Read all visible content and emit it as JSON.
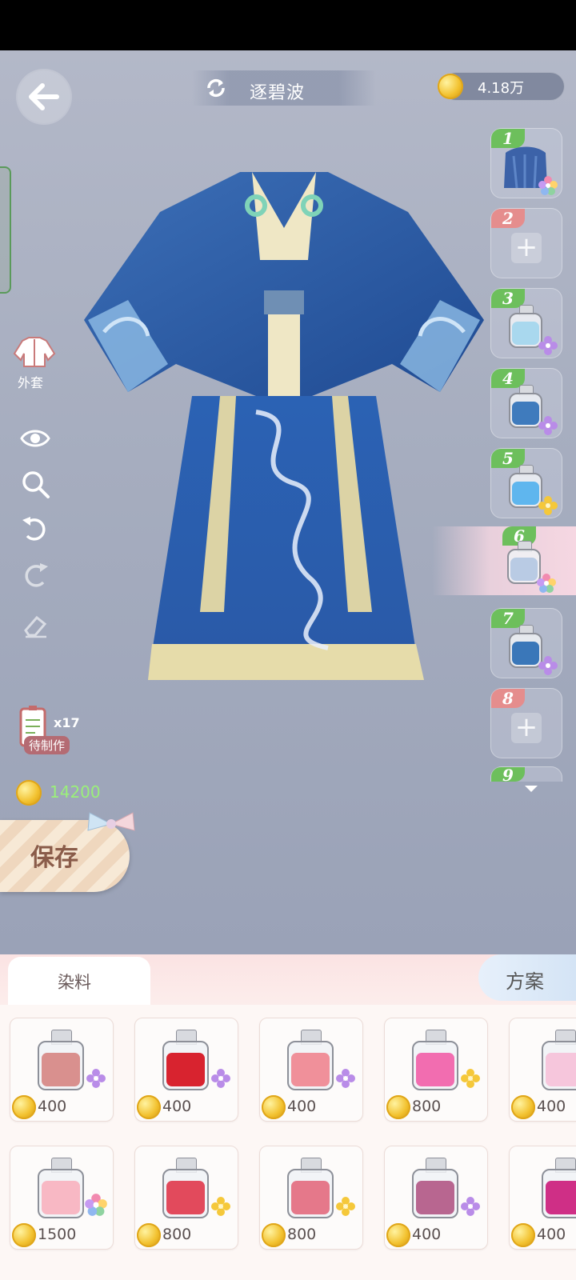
{
  "header": {
    "outfit_name": "逐碧波",
    "currency": "4.18万"
  },
  "toolbar": {
    "coat_label": "外套"
  },
  "craft": {
    "count": "x17",
    "label": "待制作",
    "cost": "14200"
  },
  "save_label": "保存",
  "slots": [
    {
      "num": "1",
      "state": "filled-fabric"
    },
    {
      "num": "2",
      "state": "empty"
    },
    {
      "num": "3",
      "state": "filled",
      "color": "#a9d8ee",
      "flower": "purple"
    },
    {
      "num": "4",
      "state": "filled",
      "color": "#3f7bbd",
      "flower": "purple"
    },
    {
      "num": "5",
      "state": "filled",
      "color": "#5fb6ee",
      "flower": "gold"
    },
    {
      "num": "6",
      "state": "filled-active",
      "color": "#b9cbe4",
      "flower": "rainbow"
    },
    {
      "num": "7",
      "state": "filled",
      "color": "#3a77b9",
      "flower": "purple"
    },
    {
      "num": "8",
      "state": "empty"
    },
    {
      "num": "9",
      "state": "partial"
    }
  ],
  "tabs": {
    "dye": "染料",
    "plan": "方案"
  },
  "dyes": [
    {
      "price": "400",
      "color": "#d9908e",
      "flower": "purple"
    },
    {
      "price": "400",
      "color": "#d8232f",
      "flower": "purple"
    },
    {
      "price": "400",
      "color": "#f0909a",
      "flower": "purple"
    },
    {
      "price": "800",
      "color": "#f26db0",
      "flower": "gold"
    },
    {
      "price": "400",
      "color": "#f6c6dc",
      "flower": "none"
    },
    {
      "price": "1500",
      "color": "#f8b8c4",
      "flower": "rainbow"
    },
    {
      "price": "800",
      "color": "#e24a5c",
      "flower": "gold"
    },
    {
      "price": "800",
      "color": "#e5788a",
      "flower": "gold"
    },
    {
      "price": "400",
      "color": "#b86690",
      "flower": "purple"
    },
    {
      "price": "400",
      "color": "#cf2f86",
      "flower": "none"
    }
  ]
}
